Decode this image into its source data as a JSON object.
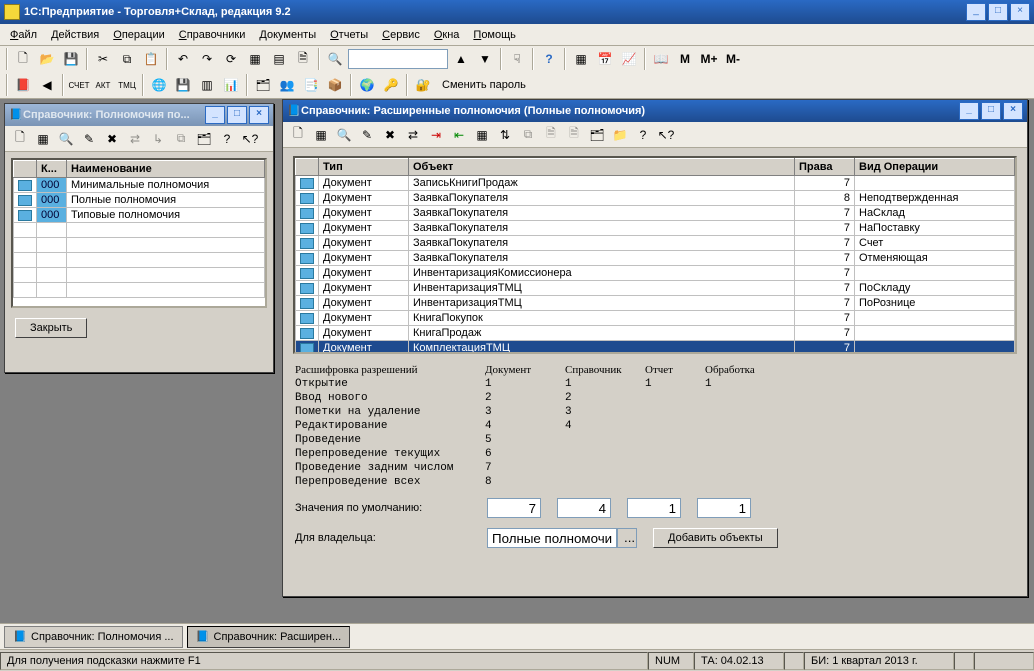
{
  "app": {
    "title": "1С:Предприятие - Торговля+Склад, редакция 9.2",
    "menus": [
      "Файл",
      "Действия",
      "Операции",
      "Справочники",
      "Документы",
      "Отчеты",
      "Сервис",
      "Окна",
      "Помощь"
    ],
    "toolbar2_text": "Сменить пароль",
    "m_buttons": [
      "M",
      "M+",
      "M-"
    ]
  },
  "win1": {
    "title": "Справочник: Полномочия по...",
    "columns": [
      "",
      "К...",
      "Наименование"
    ],
    "rows": [
      {
        "code": "000",
        "name": "Минимальные полномочия"
      },
      {
        "code": "000",
        "name": "Полные полномочия"
      },
      {
        "code": "000",
        "name": "Типовые полномочия"
      }
    ],
    "close_btn": "Закрыть"
  },
  "win2": {
    "title": "Справочник: Расширенные полномочия (Полные полномочия)",
    "columns": [
      "",
      "Тип",
      "Объект",
      "Права",
      "Вид Операции"
    ],
    "rows": [
      {
        "type": "Документ",
        "obj": "ЗаписьКнигиПродаж",
        "rights": "7",
        "op": ""
      },
      {
        "type": "Документ",
        "obj": "ЗаявкаПокупателя",
        "rights": "8",
        "op": "Неподтвержденная"
      },
      {
        "type": "Документ",
        "obj": "ЗаявкаПокупателя",
        "rights": "7",
        "op": "НаСклад"
      },
      {
        "type": "Документ",
        "obj": "ЗаявкаПокупателя",
        "rights": "7",
        "op": "НаПоставку"
      },
      {
        "type": "Документ",
        "obj": "ЗаявкаПокупателя",
        "rights": "7",
        "op": "Счет"
      },
      {
        "type": "Документ",
        "obj": "ЗаявкаПокупателя",
        "rights": "7",
        "op": "Отменяющая"
      },
      {
        "type": "Документ",
        "obj": "ИнвентаризацияКомиссионера",
        "rights": "7",
        "op": ""
      },
      {
        "type": "Документ",
        "obj": "ИнвентаризацияТМЦ",
        "rights": "7",
        "op": "ПоСкладу"
      },
      {
        "type": "Документ",
        "obj": "ИнвентаризацияТМЦ",
        "rights": "7",
        "op": "ПоРознице"
      },
      {
        "type": "Документ",
        "obj": "КнигаПокупок",
        "rights": "7",
        "op": ""
      },
      {
        "type": "Документ",
        "obj": "КнигаПродаж",
        "rights": "7",
        "op": ""
      },
      {
        "type": "Документ",
        "obj": "КомплектацияТМЦ",
        "rights": "7",
        "op": "",
        "hl": true
      }
    ],
    "perm_header": "Расшифровка разрешений",
    "perm_cols": [
      "Документ",
      "Справочник",
      "Отчет",
      "Обработка"
    ],
    "perm_rows": [
      {
        "label": "Открытие",
        "vals": [
          "1",
          "1",
          "1",
          "1"
        ]
      },
      {
        "label": "Ввод нового",
        "vals": [
          "2",
          "2",
          "",
          ""
        ]
      },
      {
        "label": "Пометки на удаление",
        "vals": [
          "3",
          "3",
          "",
          ""
        ]
      },
      {
        "label": "Редактирование",
        "vals": [
          "4",
          "4",
          "",
          ""
        ]
      },
      {
        "label": "Проведение",
        "vals": [
          "5",
          "",
          "",
          ""
        ]
      },
      {
        "label": "Перепроведение текущих",
        "vals": [
          "6",
          "",
          "",
          ""
        ]
      },
      {
        "label": "Проведение задним числом",
        "vals": [
          "7",
          "",
          "",
          ""
        ]
      },
      {
        "label": "Перепроведение всех",
        "vals": [
          "8",
          "",
          "",
          ""
        ]
      }
    ],
    "defaults_label": "Значения по умолчанию:",
    "defaults": [
      "7",
      "4",
      "1",
      "1"
    ],
    "owner_label": "Для владельца:",
    "owner_value": "Полные полномочия",
    "add_btn": "Добавить объекты"
  },
  "taskbar": {
    "b1": "Справочник: Полномочия ...",
    "b2": "Справочник: Расширен..."
  },
  "status": {
    "hint": "Для получения подсказки нажмите F1",
    "num": "NUM",
    "ta": "ТА: 04.02.13",
    "bi": "БИ: 1 квартал 2013 г."
  }
}
